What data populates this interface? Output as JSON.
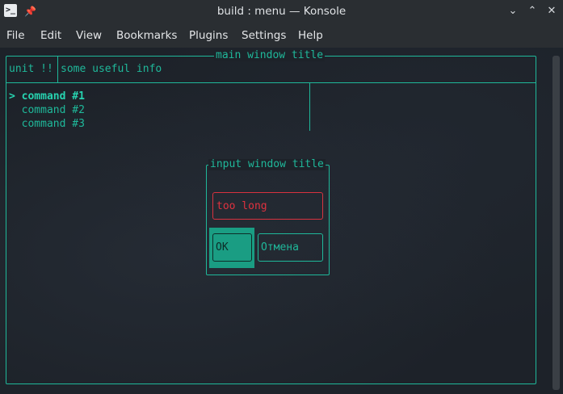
{
  "window": {
    "title": "build : menu — Konsole",
    "app_icon_glyph": ">_",
    "pin_icon": "pin-icon",
    "controls": {
      "minimize": "⌄",
      "maximize": "⌃",
      "close": "✕"
    }
  },
  "menubar": {
    "items": [
      {
        "label": "File"
      },
      {
        "label": "Edit"
      },
      {
        "label": "View"
      },
      {
        "label": "Bookmarks"
      },
      {
        "label": "Plugins"
      },
      {
        "label": "Settings"
      },
      {
        "label": "Help"
      }
    ]
  },
  "terminal": {
    "main_window_title": "main window title",
    "header": {
      "unit": "unit !!",
      "info": "some useful info"
    },
    "commands": [
      {
        "prefix": "> ",
        "label": "command #1",
        "selected": true
      },
      {
        "prefix": "  ",
        "label": "command #2",
        "selected": false
      },
      {
        "prefix": "  ",
        "label": "command #3",
        "selected": false
      }
    ],
    "input_window": {
      "title": "input window title",
      "error_value": "too long",
      "ok_label": "OK",
      "cancel_label": "Отмена"
    }
  },
  "colors": {
    "accent": "#1fb89a",
    "error": "#d8323f",
    "background": "#1d2229",
    "chrome": "#2a2e32"
  }
}
